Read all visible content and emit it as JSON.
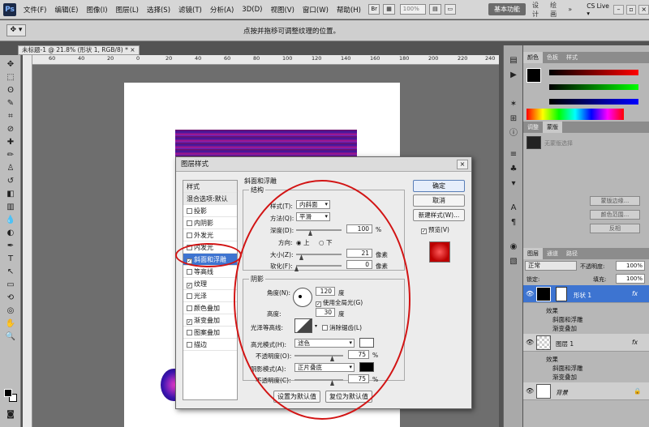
{
  "menubar": {
    "app_logo": "Ps",
    "items": [
      "文件(F)",
      "编辑(E)",
      "图像(I)",
      "图层(L)",
      "选择(S)",
      "滤镜(T)",
      "分析(A)",
      "3D(D)",
      "视图(V)",
      "窗口(W)",
      "帮助(H)"
    ],
    "zoom": "100%",
    "workspace_active": "基本功能",
    "workspaces": [
      "设计",
      "绘画"
    ],
    "cs_live": "CS Live ▾"
  },
  "options_bar": {
    "hint": "点按并拖移可调整纹理的位置。"
  },
  "document": {
    "tab_title": "未标题-1 @ 21.8% (形状 1, RGB/8) * ×",
    "ruler_ticks": [
      "60",
      "40",
      "20",
      "0",
      "20",
      "40",
      "60",
      "80",
      "100",
      "120",
      "140",
      "160",
      "180",
      "200",
      "220",
      "240"
    ]
  },
  "colors": {
    "accent_red": "#d21414",
    "selection_blue": "#3e74d0"
  },
  "panels": {
    "color_tabs": [
      "颜色",
      "色板",
      "样式"
    ],
    "adjust_tabs": [
      "调整",
      "蒙版"
    ],
    "adjust_hint": "无蒙版选择",
    "mask_buttons": [
      "蒙版边缘...",
      "颜色范围...",
      "反相"
    ],
    "layers_tabs": [
      "图层",
      "通道",
      "路径"
    ],
    "blend_mode": "正常",
    "opacity_label": "不透明度:",
    "opacity_value": "100%",
    "lock_label": "锁定:",
    "fill_label": "填充:",
    "fill_value": "100%",
    "layers": [
      {
        "name": "形状 1",
        "effects_label": "效果",
        "effects": [
          "斜面和浮雕",
          "渐变叠加"
        ]
      },
      {
        "name": "图层 1",
        "effects_label": "效果",
        "effects": [
          "斜面和浮雕",
          "渐变叠加"
        ]
      },
      {
        "name": "背景"
      }
    ],
    "fx_label": "fx"
  },
  "dialog": {
    "title": "图层样式",
    "styles_header": "样式",
    "styles": [
      {
        "label": "混合选项:默认",
        "checkbox": false,
        "checked": false
      },
      {
        "label": "投影",
        "checkbox": true,
        "checked": false
      },
      {
        "label": "内阴影",
        "checkbox": true,
        "checked": false
      },
      {
        "label": "外发光",
        "checkbox": true,
        "checked": false
      },
      {
        "label": "内发光",
        "checkbox": true,
        "checked": false
      },
      {
        "label": "斜面和浮雕",
        "checkbox": true,
        "checked": true
      },
      {
        "label": "等高线",
        "checkbox": true,
        "checked": false
      },
      {
        "label": "纹理",
        "checkbox": true,
        "checked": true
      },
      {
        "label": "光泽",
        "checkbox": true,
        "checked": false
      },
      {
        "label": "颜色叠加",
        "checkbox": true,
        "checked": false
      },
      {
        "label": "渐变叠加",
        "checkbox": true,
        "checked": true
      },
      {
        "label": "图案叠加",
        "checkbox": true,
        "checked": false
      },
      {
        "label": "描边",
        "checkbox": true,
        "checked": false
      }
    ],
    "section_title": "斜面和浮雕",
    "structure": {
      "title": "结构",
      "style_label": "样式(T):",
      "style_value": "内斜面",
      "technique_label": "方法(Q):",
      "technique_value": "平滑",
      "depth_label": "深度(D):",
      "depth_value": "100",
      "depth_unit": "%",
      "direction_label": "方向:",
      "dir_up": "上",
      "dir_down": "下",
      "size_label": "大小(Z):",
      "size_value": "21",
      "size_unit": "像素",
      "soften_label": "软化(F):",
      "soften_value": "0",
      "soften_unit": "像素"
    },
    "shading": {
      "title": "阴影",
      "angle_label": "角度(N):",
      "angle_value": "120",
      "angle_unit": "度",
      "global_light": "使用全局光(G)",
      "altitude_label": "高度:",
      "altitude_value": "30",
      "altitude_unit": "度",
      "gloss_label": "光泽等高线:",
      "antialias": "消除锯齿(L)",
      "highlight_label": "高光模式(H):",
      "highlight_value": "滤色",
      "highlight_opacity_label": "不透明度(O):",
      "highlight_opacity": "75",
      "shadow_label": "阴影模式(A):",
      "shadow_value": "正片叠底",
      "shadow_opacity_label": "不透明度(C):",
      "shadow_opacity": "75",
      "percent": "%"
    },
    "buttons": {
      "ok": "确定",
      "cancel": "取消",
      "new_style": "新建样式(W)...",
      "preview": "预览(V)",
      "make_default": "设置为默认值",
      "reset_default": "复位为默认值"
    },
    "highlight_color": "#ffffff",
    "shadow_color": "#000000"
  }
}
